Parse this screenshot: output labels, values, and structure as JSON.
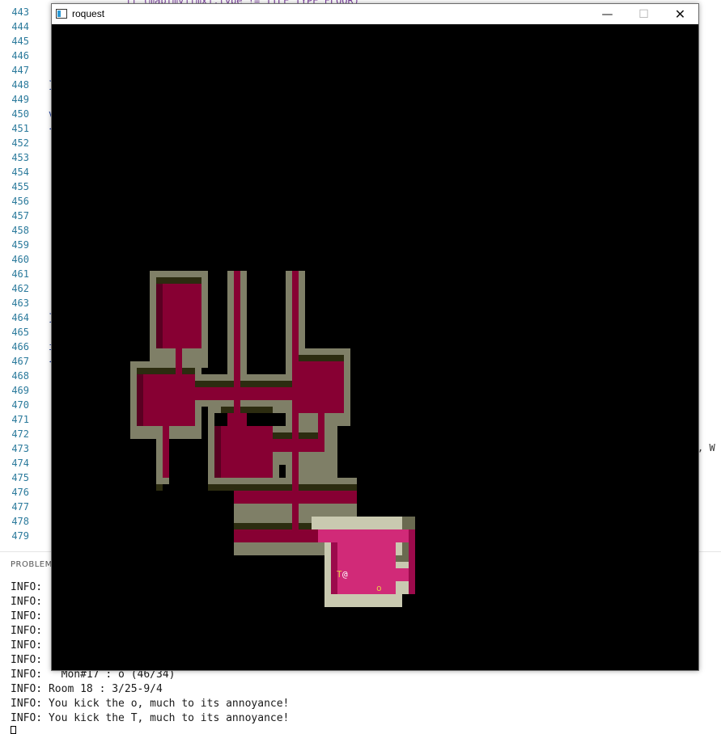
{
  "editor": {
    "line_numbers": [
      "443",
      "444",
      "445",
      "446",
      "447",
      "448",
      "449",
      "450",
      "451",
      "452",
      "453",
      "454",
      "455",
      "456",
      "457",
      "458",
      "459",
      "460",
      "461",
      "462",
      "463",
      "464",
      "465",
      "466",
      "467",
      "468",
      "469",
      "470",
      "471",
      "472",
      "473",
      "474",
      "475",
      "476",
      "477",
      "478",
      "479"
    ],
    "code_top_fragment": "if (map[my][mx].type != TILE_TYPE_FLOOR)",
    "code_right_fragment": ", W",
    "panel_title": "PROBLEMS"
  },
  "log": {
    "lines": [
      "INFO: ",
      "INFO: ",
      "INFO: ",
      "INFO: ",
      "INFO: ",
      "INFO: ",
      "INFO:   Mon#17 : o (46/34)",
      "INFO: Room 18 : 3/25-9/4",
      "INFO: You kick the o, much to its annoyance!",
      "INFO: You kick the T, much to its annoyance!"
    ]
  },
  "window": {
    "title": "roquest",
    "minimize_glyph": "—",
    "maximize_glyph": "☐",
    "close_glyph": "✕"
  },
  "game": {
    "player_glyph": "@",
    "monsters": [
      {
        "glyph": "T",
        "color": "#e8c84a"
      },
      {
        "glyph": "o",
        "color": "#e8c84a"
      }
    ],
    "colors": {
      "wall": "#7f7f67",
      "wall_lit": "#c9c9b0",
      "floor": "#870033",
      "floor_lit": "#d12a78",
      "shadow": "#2c2c10",
      "background": "#000000",
      "player": "#ffffff"
    }
  }
}
